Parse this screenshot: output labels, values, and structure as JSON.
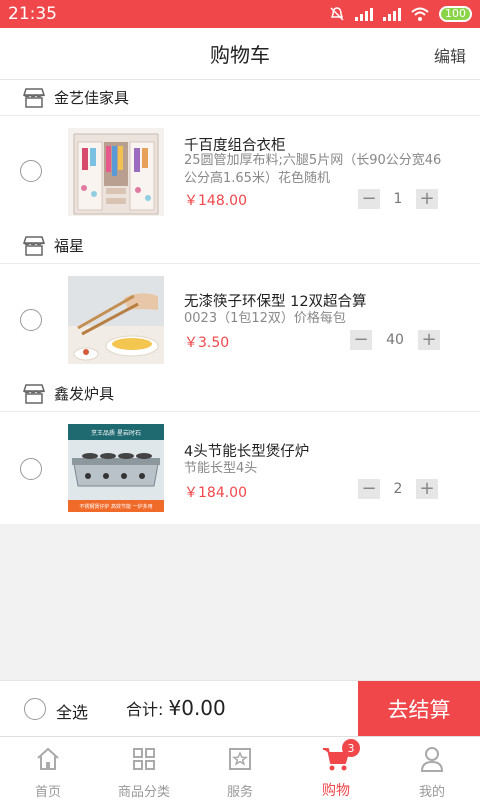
{
  "status_bar": {
    "time": "21:35",
    "battery": "100"
  },
  "header": {
    "title": "购物车",
    "edit_label": "编辑"
  },
  "shops": [
    {
      "name": "金艺佳家具",
      "items": [
        {
          "title": "千百度组合衣柜",
          "spec": "25圆管加厚布料;六腿5片网（长90公分宽46公分高1.65米）花色随机",
          "price": "￥148.00",
          "quantity": "1"
        }
      ]
    },
    {
      "name": "福星",
      "items": [
        {
          "title": "无漆筷子环保型  12双超合算",
          "spec": "0023（1包12双）价格每包",
          "price": "￥3.50",
          "quantity": "40"
        }
      ]
    },
    {
      "name": "鑫发炉具",
      "items": [
        {
          "title": "4头节能长型煲仔炉",
          "spec": "节能长型4头",
          "price": "￥184.00",
          "quantity": "2"
        }
      ]
    }
  ],
  "product_image_text": {
    "stove_top": "烹王品质  星岩时石",
    "stove_bottom": "不锈钢煲仔炉  高效节能  一炉多用"
  },
  "footer": {
    "select_all_label": "全选",
    "total_label": "合计:",
    "total_amount": "¥0.00",
    "checkout_label": "去结算"
  },
  "tabbar": {
    "tabs": [
      {
        "label": "首页",
        "icon": "home-icon"
      },
      {
        "label": "商品分类",
        "icon": "grid-icon"
      },
      {
        "label": "服务",
        "icon": "star-square-icon"
      },
      {
        "label": "购物",
        "icon": "cart-icon",
        "badge": "3",
        "active": true
      },
      {
        "label": "我的",
        "icon": "user-icon"
      }
    ]
  },
  "colors": {
    "accent": "#f0474b",
    "status_bar": "#f0474b",
    "background": "#f2f2f2"
  }
}
